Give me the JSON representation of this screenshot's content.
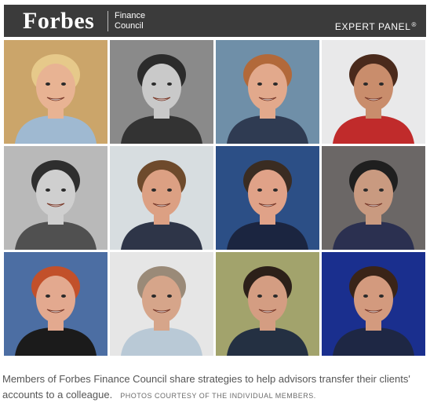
{
  "header": {
    "logo": "Forbes",
    "council_line1": "Finance",
    "council_line2": "Council",
    "panel_label": "EXPERT PANEL",
    "panel_mark": "®"
  },
  "photos": [
    {
      "bg": "#cba56a",
      "skin": "#e8b393",
      "hair": "#e6c98a",
      "shirt": "#9fb9d1"
    },
    {
      "bg": "#8a8a8a",
      "skin": "#c9c9c9",
      "hair": "#2b2b2b",
      "shirt": "#333333"
    },
    {
      "bg": "#6f8fa8",
      "skin": "#e2a98c",
      "hair": "#b2693a",
      "shirt": "#2f3b52"
    },
    {
      "bg": "#e9e9ea",
      "skin": "#c98d6c",
      "hair": "#4a2a1c",
      "shirt": "#c02b2b"
    },
    {
      "bg": "#b9b9b9",
      "skin": "#cfcfcf",
      "hair": "#2e2e2e",
      "shirt": "#505050"
    },
    {
      "bg": "#d7dde0",
      "skin": "#dca083",
      "hair": "#6e4a2c",
      "shirt": "#2e3548"
    },
    {
      "bg": "#2c4f86",
      "skin": "#e0a288",
      "hair": "#3a2c22",
      "shirt": "#1b2540"
    },
    {
      "bg": "#6b6766",
      "skin": "#c99a80",
      "hair": "#1f1f1f",
      "shirt": "#2b3050"
    },
    {
      "bg": "#4c6ea3",
      "skin": "#e3a98f",
      "hair": "#c2502a",
      "shirt": "#1b1b1b"
    },
    {
      "bg": "#e6e6e6",
      "skin": "#d6a58a",
      "hair": "#9a8a78",
      "shirt": "#b9c9d6"
    },
    {
      "bg": "#a2a36c",
      "skin": "#d49d82",
      "hair": "#2c2019",
      "shirt": "#243042"
    },
    {
      "bg": "#1a2f8e",
      "skin": "#d39a7e",
      "hair": "#3a2418",
      "shirt": "#1e2744"
    }
  ],
  "caption": {
    "text": "Members of Forbes Finance Council share strategies to help advisors transfer their clients' accounts to a colleague.",
    "credit": "PHOTOS COURTESY OF THE INDIVIDUAL MEMBERS."
  }
}
